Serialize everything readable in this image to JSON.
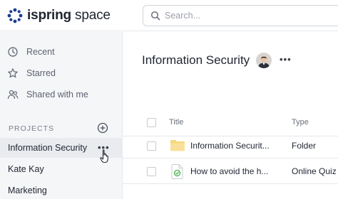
{
  "app": {
    "logo_prefix": "ispring",
    "logo_suffix": "space",
    "brand_color": "#1a3d8f",
    "accent_color": "#4caf50"
  },
  "search": {
    "placeholder": "Search..."
  },
  "sidebar": {
    "nav": [
      {
        "label": "Recent",
        "icon": "clock-icon"
      },
      {
        "label": "Starred",
        "icon": "star-icon"
      },
      {
        "label": "Shared with me",
        "icon": "people-icon"
      }
    ],
    "projects_label": "PROJECTS",
    "projects": [
      {
        "label": "Information Security",
        "active": true
      },
      {
        "label": "Kate Kay",
        "active": false
      },
      {
        "label": "Marketing",
        "active": false
      }
    ]
  },
  "main": {
    "title": "Information Security",
    "more": "•••",
    "table": {
      "headers": {
        "title": "Title",
        "type": "Type"
      },
      "rows": [
        {
          "title": "Information Securit...",
          "type": "Folder",
          "icon": "folder-icon"
        },
        {
          "title": "How to avoid the h...",
          "type": "Online Quiz",
          "icon": "quiz-icon"
        }
      ]
    }
  },
  "more_glyph": "•••"
}
